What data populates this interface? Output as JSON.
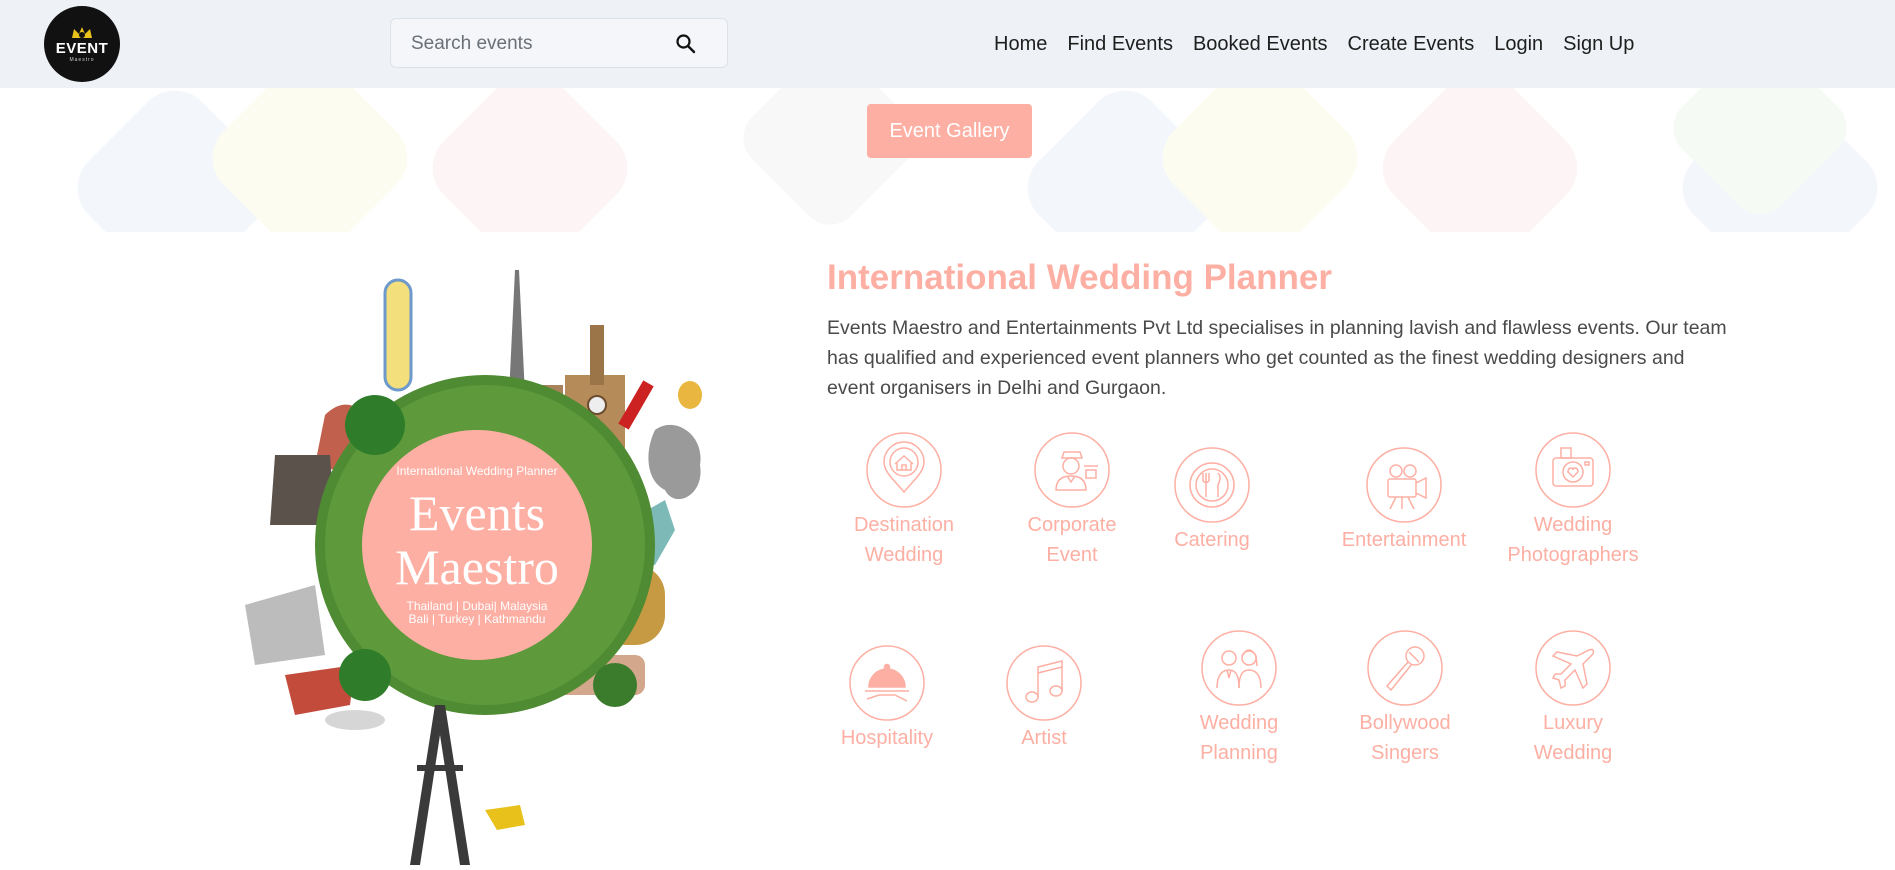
{
  "logo": {
    "text": "EVENT",
    "sub": "Maestro"
  },
  "search": {
    "placeholder": "Search events"
  },
  "nav": {
    "items": [
      "Home",
      "Find Events",
      "Booked Events",
      "Create Events",
      "Login",
      "Sign Up"
    ]
  },
  "gallery_button": "Event Gallery",
  "hero": {
    "small": "International Wedding Planner",
    "line1": "Events",
    "line2": "Maestro",
    "locations1": "Thailand | Dubai| Malaysia",
    "locations2": "Bali | Turkey | Kathmandu"
  },
  "section": {
    "title": "International Wedding Planner",
    "description": "Events Maestro and Entertainments Pvt Ltd specialises in planning lavish and flawless events. Our team has qualified and experienced event planners who get counted as the finest wedding designers and event organisers in Delhi and Gurgaon."
  },
  "services": {
    "destination": {
      "l1": "Destination",
      "l2": "Wedding"
    },
    "corporate": {
      "l1": "Corporate",
      "l2": "Event"
    },
    "catering": {
      "l1": "Catering"
    },
    "entertainment": {
      "l1": "Entertainment"
    },
    "photographers": {
      "l1": "Wedding",
      "l2": "Photographers"
    },
    "hospitality": {
      "l1": "Hospitality"
    },
    "artist": {
      "l1": "Artist"
    },
    "planning": {
      "l1": "Wedding",
      "l2": "Planning"
    },
    "bollywood": {
      "l1": "Bollywood",
      "l2": "Singers"
    },
    "luxury": {
      "l1": "Luxury",
      "l2": "Wedding"
    }
  },
  "colors": {
    "accent": "#fdafa3",
    "navbar": "#eef2f6",
    "text": "#4a4a4a"
  }
}
